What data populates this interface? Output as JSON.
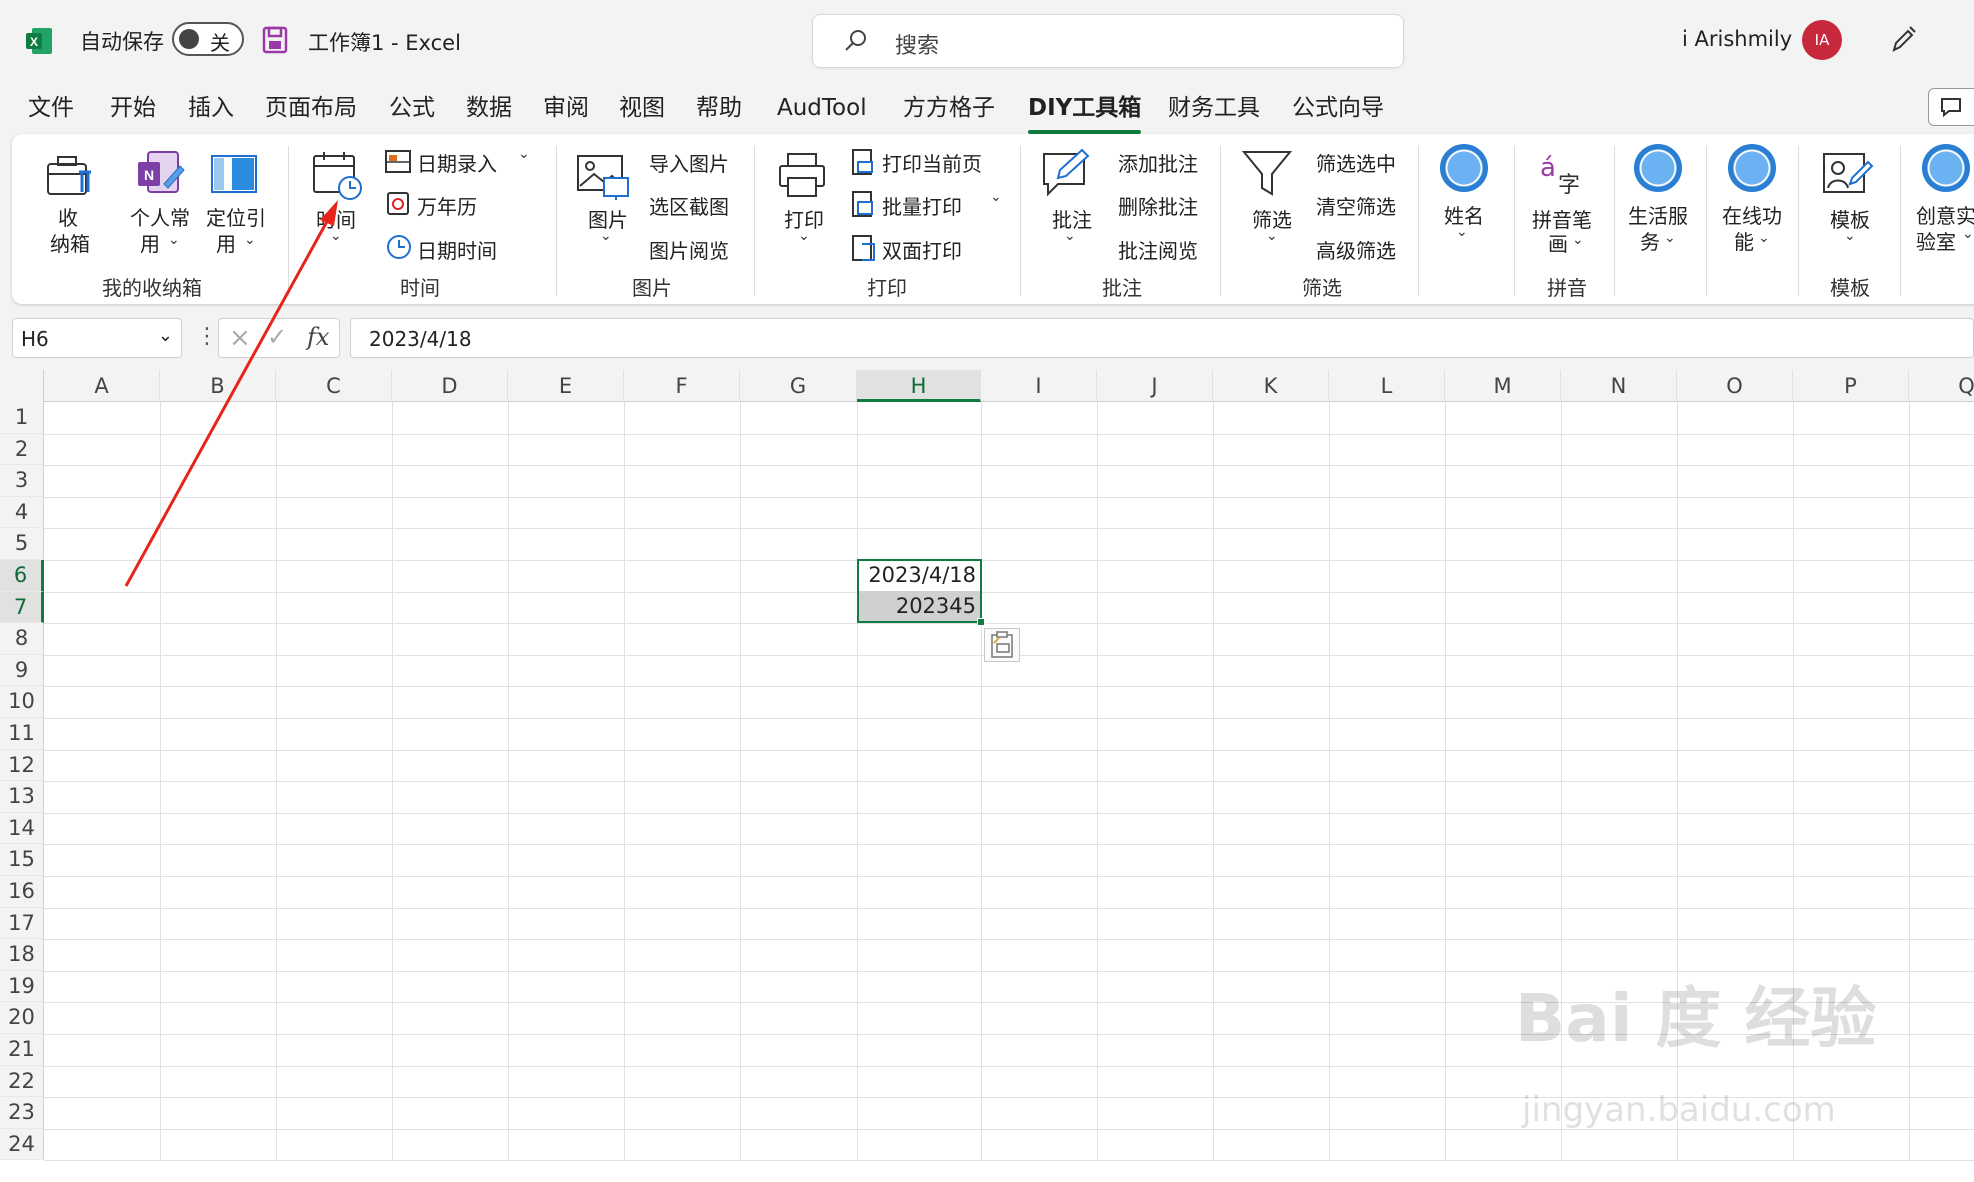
{
  "title_bar": {
    "autosave_label": "自动保存",
    "autosave_state": "关",
    "doc_title": "工作簿1  -  Excel",
    "search_placeholder": "搜索",
    "user_name": "i Arishmily",
    "avatar_initials": "IA"
  },
  "menu_tabs": [
    "文件",
    "开始",
    "插入",
    "页面布局",
    "公式",
    "数据",
    "审阅",
    "视图",
    "帮助",
    "AudTool",
    "方方格子",
    "DIY工具箱",
    "财务工具",
    "公式向导"
  ],
  "active_tab": "DIY工具箱",
  "ribbon": {
    "storage": {
      "group": "我的收纳箱",
      "box_top": "收",
      "box_bottom": "纳箱",
      "personal_top": "个人常",
      "personal_bottom": "用",
      "locate_top": "定位引",
      "locate_bottom": "用"
    },
    "time": {
      "group": "时间",
      "time_btn": "时间",
      "date_entry": "日期录入",
      "calendar": "万年历",
      "datetime": "日期时间"
    },
    "picture": {
      "group": "图片",
      "picture_btn": "图片",
      "import_picture": "导入图片",
      "screenshot": "选区截图",
      "browse_picture": "图片阅览"
    },
    "print": {
      "group": "打印",
      "print_btn": "打印",
      "print_current": "打印当前页",
      "batch_print": "批量打印",
      "duplex_print": "双面打印"
    },
    "comment": {
      "group": "批注",
      "comment_btn": "批注",
      "add_comment": "添加批注",
      "delete_comment": "删除批注",
      "browse_comment": "批注阅览"
    },
    "filter": {
      "group": "筛选",
      "filter_btn": "筛选",
      "filter_selected": "筛选选中",
      "clear_filter": "清空筛选",
      "advanced_filter": "高级筛选"
    },
    "name": {
      "label": "姓名"
    },
    "pinyin": {
      "group": "拼音",
      "pinyin_top": "拼音笔",
      "pinyin_bottom": "画"
    },
    "life": {
      "top": "生活服",
      "bottom": "务"
    },
    "online": {
      "top": "在线功",
      "bottom": "能"
    },
    "template": {
      "group": "模板",
      "template_btn": "模板"
    },
    "creative": {
      "top": "创意实",
      "bottom": "验室"
    }
  },
  "formula_bar": {
    "name_box": "H6",
    "fx": "fx",
    "formula": "2023/4/18"
  },
  "sheet": {
    "columns": [
      "A",
      "B",
      "C",
      "D",
      "E",
      "F",
      "G",
      "H",
      "I",
      "J",
      "K",
      "L",
      "M",
      "N",
      "O",
      "P",
      "Q"
    ],
    "rows": [
      "1",
      "2",
      "3",
      "4",
      "5",
      "6",
      "7",
      "8",
      "9",
      "10",
      "11",
      "12",
      "13",
      "14",
      "15",
      "16",
      "17",
      "18",
      "19",
      "20",
      "21",
      "22",
      "23",
      "24"
    ],
    "selected_column": "H",
    "selected_rows": [
      "6",
      "7"
    ],
    "cells": {
      "H6": "2023/4/18",
      "H7": "202345"
    }
  },
  "watermark": {
    "brand": "Bai 度 经验",
    "url": "jingyan.baidu.com"
  },
  "colors": {
    "accent": "#107c41",
    "avatar": "#c7283c",
    "arrow": "#e8231c",
    "ribbon_blue": "#2a7fd4"
  }
}
